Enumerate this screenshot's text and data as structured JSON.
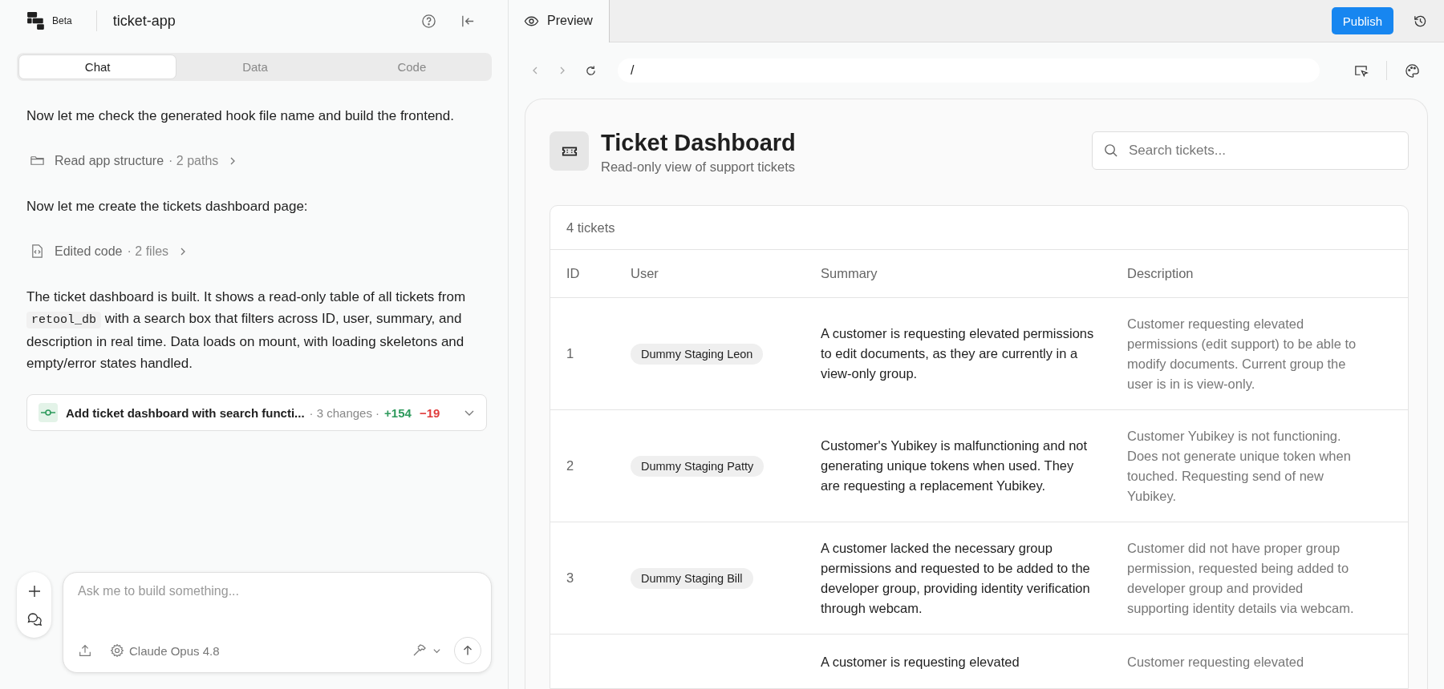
{
  "header": {
    "badge": "Beta",
    "project": "ticket-app"
  },
  "tabs": [
    {
      "label": "Chat",
      "selected": true
    },
    {
      "label": "Data",
      "selected": false
    },
    {
      "label": "Code",
      "selected": false
    }
  ],
  "messages": [
    {
      "kind": "text",
      "text": "Now let me check the generated hook file name and build the frontend."
    },
    {
      "kind": "read",
      "label": "Read app structure",
      "meta": "· 2 paths"
    },
    {
      "kind": "text",
      "text": "Now let me create the tickets dashboard page:"
    },
    {
      "kind": "edit",
      "label": "Edited code",
      "meta": "· 2 files"
    },
    {
      "kind": "paragraph",
      "parts": [
        {
          "text": "The ticket dashboard is built. It shows a read-only table of all tickets from",
          "code": false
        },
        {
          "text": "retool_db",
          "code": true
        },
        {
          "text": "with a search box that filters across ID, user, summary, and description in real time. Data loads on mount, with loading skeletons and empty/error states handled.",
          "code": false
        }
      ]
    },
    {
      "kind": "commit",
      "label": "Add ticket dashboard with search functi...",
      "meta": "· 3 changes ·",
      "added": "+154",
      "removed": "−19"
    }
  ],
  "composer": {
    "placeholder": "Ask me to build something...",
    "model": "Claude Opus 4.8"
  },
  "preview": {
    "tab": "Preview",
    "publish": "Publish",
    "url": "/"
  },
  "dashboard": {
    "title": "Ticket Dashboard",
    "subtitle": "Read-only view of support tickets",
    "search_placeholder": "Search tickets...",
    "count": "4 tickets",
    "columns": [
      "ID",
      "User",
      "Summary",
      "Description"
    ],
    "rows": [
      {
        "id": "1",
        "user": "Dummy Staging Leon",
        "summary": "A customer is requesting elevated permissions to edit documents, as they are currently in a view-only group.",
        "description": "Customer requesting elevated permissions (edit support) to be able to modify documents. Current group the user is in is view-only."
      },
      {
        "id": "2",
        "user": "Dummy Staging Patty",
        "summary": "Customer's Yubikey is malfunctioning and not generating unique tokens when used. They are requesting a replacement Yubikey.",
        "description": "Customer Yubikey is not functioning. Does not generate unique token when touched. Requesting send of new Yubikey."
      },
      {
        "id": "3",
        "user": "Dummy Staging Bill",
        "summary": "A customer lacked the necessary group permissions and requested to be added to the developer group, providing identity verification through webcam.",
        "description": "Customer did not have proper group permission, requested being added to developer group and provided supporting identity details via webcam."
      },
      {
        "summary": "A customer is requesting elevated",
        "description": "Customer requesting elevated"
      }
    ]
  }
}
